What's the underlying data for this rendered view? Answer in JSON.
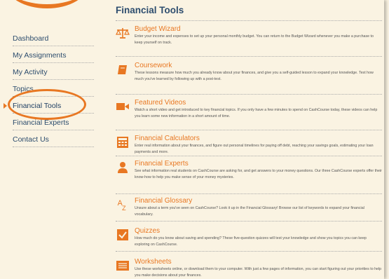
{
  "page": {
    "title": "Financial Tools"
  },
  "sidebar": {
    "items": [
      {
        "label": "Dashboard"
      },
      {
        "label": "My Assignments"
      },
      {
        "label": "My Activity"
      },
      {
        "label": "Topics"
      },
      {
        "label": "Financial Tools",
        "active": true
      },
      {
        "label": "Financial Experts"
      },
      {
        "label": "Contact Us"
      }
    ]
  },
  "tools": [
    {
      "icon": "scales-icon",
      "title": "Budget Wizard",
      "description": "Enter your income and expenses to set up your personal monthly budget. You can return to the Budget Wizard whenever you make a purchase to keep yourself on track."
    },
    {
      "icon": "book-icon",
      "title": "Coursework",
      "description": "These lessons measure how much you already know about your finances, and give you a self-guided lesson to expand your knowledge. Test how much you've learned by following up with a post-test."
    },
    {
      "icon": "video-camera-icon",
      "title": "Featured Videos",
      "description": "Watch a short video and get introduced to key financial topics. If you only have a few minutes to spend on CashCourse today, these videos can help you learn some new information in a short amount of time."
    },
    {
      "icon": "calculator-icon",
      "title": "Financial Calculators",
      "description": "Enter real information about your finances, and figure out personal timelines for paying off debt, reaching your savings goals, estimating your loan payments and more."
    },
    {
      "icon": "person-icon",
      "title": "Financial Experts",
      "description": "See what information real students on CashCourse are asking for, and get answers to your money questions. Our three CashCourse experts offer their know-how to help you make sense of your money mysteries."
    },
    {
      "icon": "a-to-z-icon",
      "title": "Financial Glossary",
      "description": "Unsure about a term you've seen on CashCourse? Look it up in the Financial Glossary! Browse our list of keywords to expand your financial vocabulary."
    },
    {
      "icon": "checkbox-icon",
      "title": "Quizzes",
      "description": "How much do you know about saving and spending? These five-question quizzes will test your knowledge and show you topics you can keep exploring on CashCourse."
    },
    {
      "icon": "worksheet-icon",
      "title": "Worksheets",
      "description": "Use these worksheets online, or download them to your computer. With just a few pages of information, you can start figuring out your priorities to help you make decisions about your finances."
    }
  ],
  "colors": {
    "accent": "#e87722",
    "nav": "#2d4d6e",
    "background": "#faf3e2"
  }
}
